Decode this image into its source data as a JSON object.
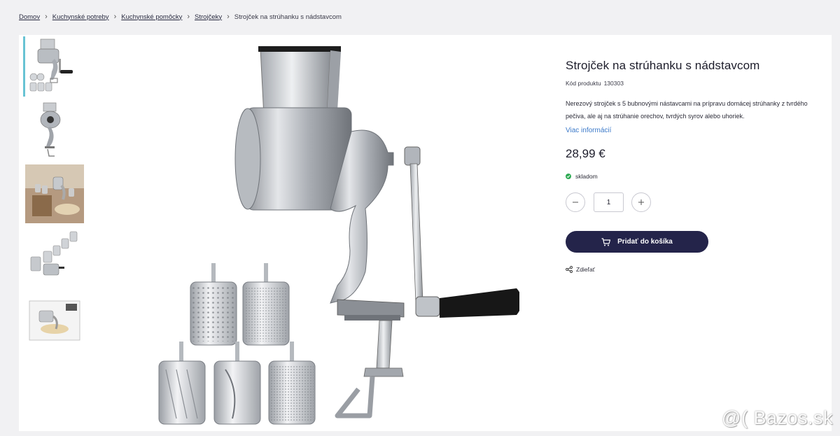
{
  "breadcrumb": {
    "items": [
      "Domov",
      "Kuchynské potreby",
      "Kuchynské pomôcky",
      "Strojčeky"
    ],
    "current": "Strojček na strúhanku s nádstavcom"
  },
  "thumbnails": [
    {
      "name": "grinder-with-drums"
    },
    {
      "name": "grinder-side-view"
    },
    {
      "name": "grinder-lifestyle-photo"
    },
    {
      "name": "drum-attachments"
    },
    {
      "name": "product-box"
    }
  ],
  "product": {
    "title": "Strojček na strúhanku s nádstavcom",
    "code_label": "Kód produktu",
    "code_value": "130303",
    "description": "Nerezový strojček s 5 bubnovými nástavcami na prípravu domácej strúhanky z tvrdého pečiva, ale aj na strúhanie orechov, tvrdých syrov alebo uhoriek.",
    "more_link": "Viac informácií",
    "price": "28,99 €",
    "stock": "skladom",
    "quantity": "1",
    "add_to_cart": "Pridať do košíka",
    "share": "Zdieľať"
  },
  "watermark": "@( Bazos.sk",
  "colors": {
    "accent": "#24244a",
    "link": "#3c7ac9",
    "in_stock": "#2eaa53",
    "active_thumb": "#68c3d4"
  }
}
